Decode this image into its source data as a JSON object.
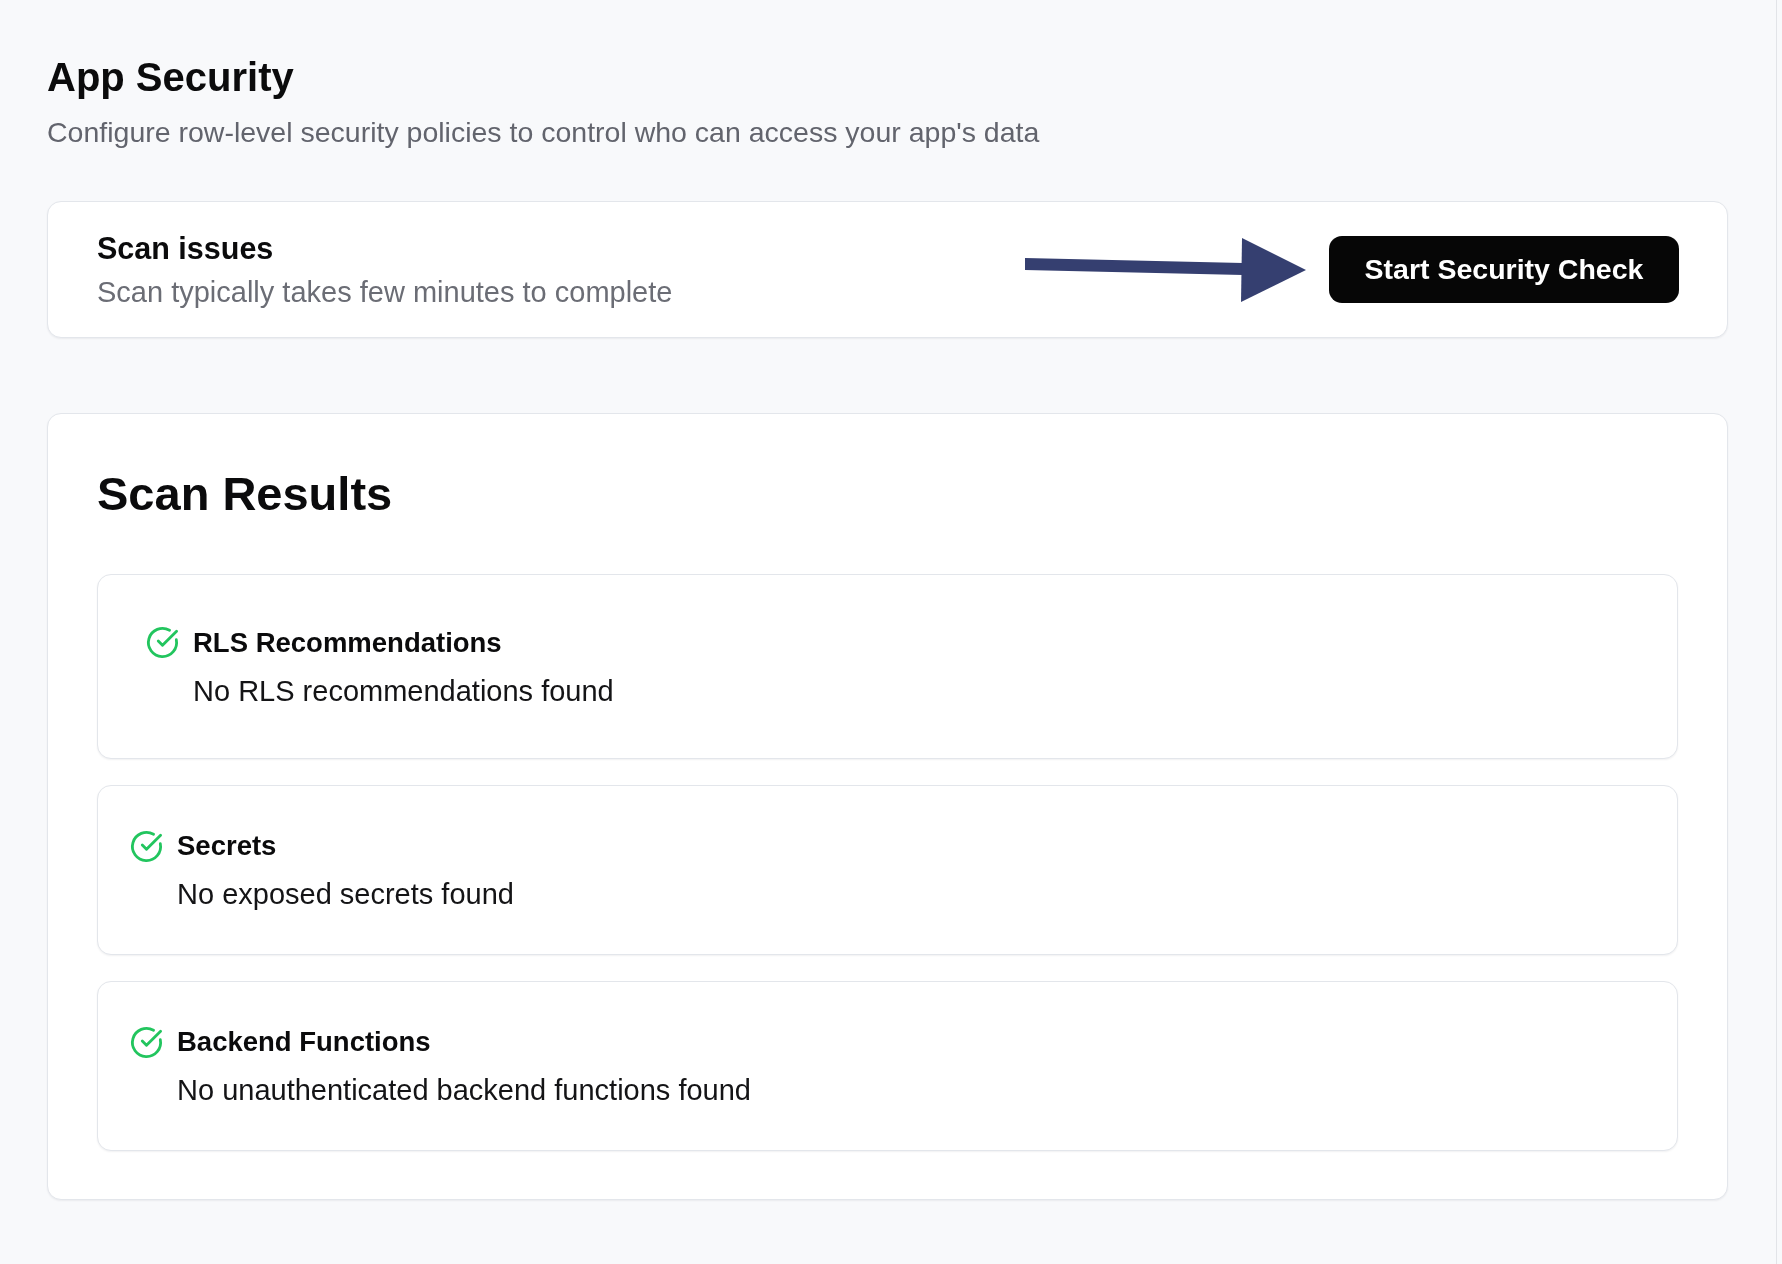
{
  "page": {
    "title": "App Security",
    "subtitle": "Configure row-level security policies to control who can access your app's data"
  },
  "scan_issues": {
    "title": "Scan issues",
    "description": "Scan typically takes few minutes to complete",
    "button": "Start Security Check"
  },
  "scan_results": {
    "title": "Scan Results",
    "items": [
      {
        "title": "RLS Recommendations",
        "description": "No RLS recommendations found",
        "passed": true
      },
      {
        "title": "Secrets",
        "description": "No exposed secrets found",
        "passed": true
      },
      {
        "title": "Backend Functions",
        "description": "No unauthenticated backend functions found",
        "passed": true
      }
    ]
  }
}
